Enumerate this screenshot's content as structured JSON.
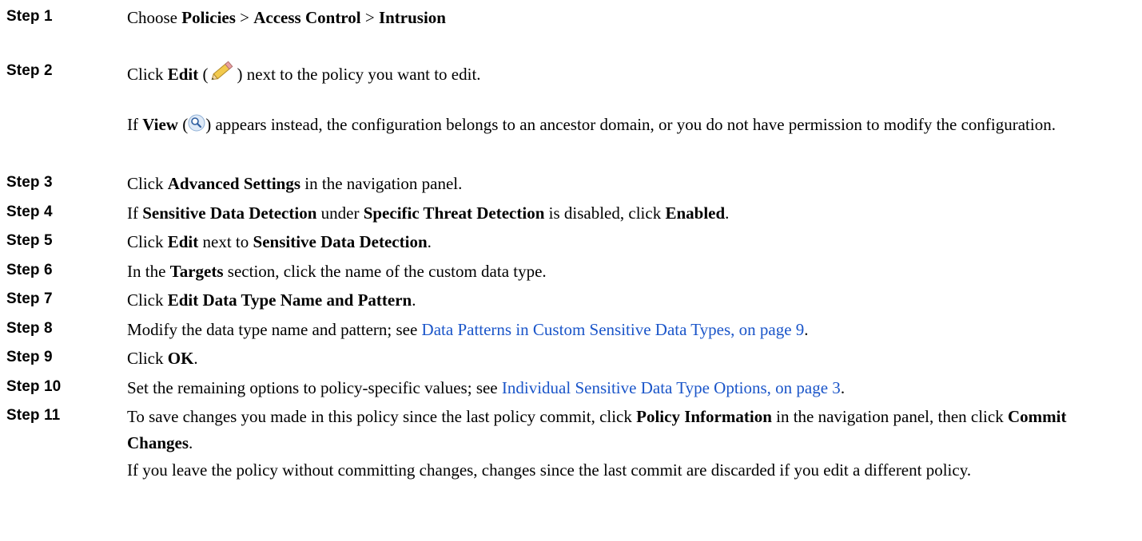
{
  "steps": [
    {
      "label": "Step 1",
      "segments": [
        {
          "t": "Choose "
        },
        {
          "t": "Policies",
          "b": true
        },
        {
          "t": " > "
        },
        {
          "t": "Access Control",
          "b": true
        },
        {
          "t": " > "
        },
        {
          "t": "Intrusion",
          "b": true
        }
      ]
    },
    {
      "label": "Step 2",
      "segments": [
        {
          "t": "Click "
        },
        {
          "t": "Edit",
          "b": true
        },
        {
          "t": " ("
        },
        {
          "icon": "pencil-icon"
        },
        {
          "t": ") next to the policy you want to edit."
        }
      ]
    },
    {
      "label": null,
      "segments": [
        {
          "t": "If "
        },
        {
          "t": "View",
          "b": true
        },
        {
          "t": " ("
        },
        {
          "icon": "magnifier-icon"
        },
        {
          "t": ") appears instead, the configuration belongs to an ancestor domain, or you do not have permission to modify the configuration."
        }
      ]
    },
    {
      "label": "Step 3",
      "segments": [
        {
          "t": "Click "
        },
        {
          "t": "Advanced Settings",
          "b": true
        },
        {
          "t": " in the navigation panel."
        }
      ]
    },
    {
      "label": "Step 4",
      "segments": [
        {
          "t": "If "
        },
        {
          "t": "Sensitive Data Detection",
          "b": true
        },
        {
          "t": " under "
        },
        {
          "t": "Specific Threat Detection",
          "b": true
        },
        {
          "t": " is disabled, click "
        },
        {
          "t": "Enabled",
          "b": true
        },
        {
          "t": "."
        }
      ]
    },
    {
      "label": "Step 5",
      "segments": [
        {
          "t": "Click "
        },
        {
          "t": "Edit",
          "b": true
        },
        {
          "t": " next to "
        },
        {
          "t": "Sensitive Data Detection",
          "b": true
        },
        {
          "t": "."
        }
      ]
    },
    {
      "label": "Step 6",
      "segments": [
        {
          "t": "In the "
        },
        {
          "t": "Targets",
          "b": true
        },
        {
          "t": " section, click the name of the custom data type."
        }
      ]
    },
    {
      "label": "Step 7",
      "segments": [
        {
          "t": "Click "
        },
        {
          "t": "Edit Data Type Name and Pattern",
          "b": true
        },
        {
          "t": "."
        }
      ]
    },
    {
      "label": "Step 8",
      "segments": [
        {
          "t": "Modify the data type name and pattern; see "
        },
        {
          "t": "Data Patterns in Custom Sensitive Data Types, on page 9",
          "link": true
        },
        {
          "t": "."
        }
      ]
    },
    {
      "label": "Step 9",
      "segments": [
        {
          "t": "Click "
        },
        {
          "t": "OK",
          "b": true
        },
        {
          "t": "."
        }
      ]
    },
    {
      "label": "Step 10",
      "segments": [
        {
          "t": "Set the remaining options to policy-specific values; see "
        },
        {
          "t": "Individual Sensitive Data Type Options, on page 3",
          "link": true
        },
        {
          "t": "."
        }
      ]
    },
    {
      "label": "Step 11",
      "segments": [
        {
          "t": "To save changes you made in this policy since the last policy commit, click "
        },
        {
          "t": "Policy Information",
          "b": true
        },
        {
          "t": " in the navigation panel, then click "
        },
        {
          "t": "Commit Changes",
          "b": true
        },
        {
          "t": "."
        }
      ]
    },
    {
      "label": null,
      "segments": [
        {
          "t": "If you leave the policy without committing changes, changes since the last commit are discarded if you edit a different policy."
        }
      ]
    }
  ]
}
